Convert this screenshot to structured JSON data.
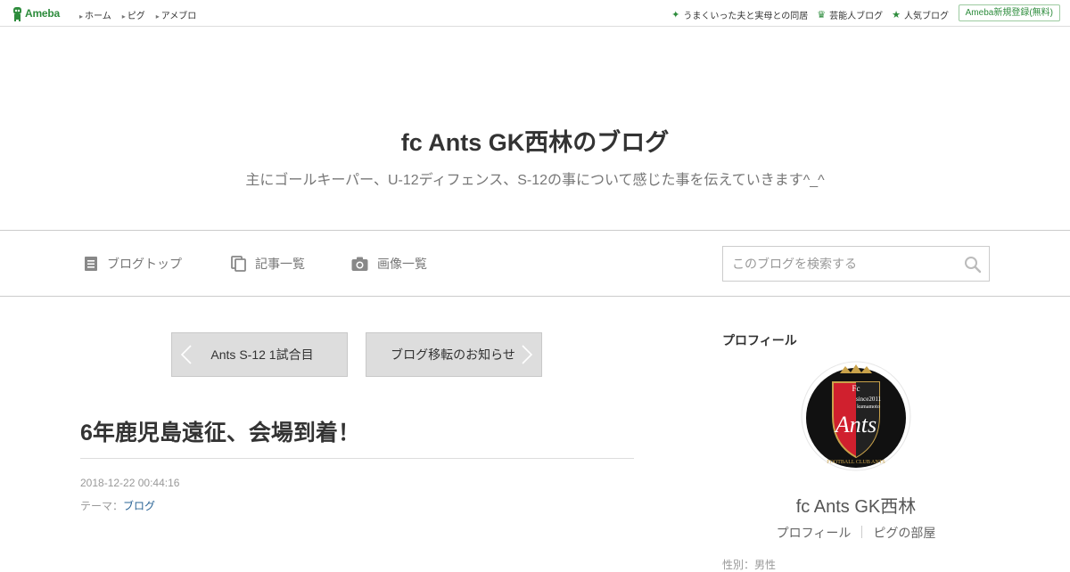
{
  "topbar": {
    "logo_text": "Ameba",
    "nav": [
      "ホーム",
      "ピグ",
      "アメブロ"
    ],
    "right_links": [
      {
        "icon": "sparkle-icon",
        "label": "うまくいった夫と実母との同居"
      },
      {
        "icon": "crown-icon",
        "label": "芸能人ブログ"
      },
      {
        "icon": "star-icon",
        "label": "人気ブログ"
      }
    ],
    "register_label": "Ameba新規登録(無料)"
  },
  "blog": {
    "title": "fc Ants GK西林のブログ",
    "description": "主にゴールキーパー、U-12ディフェンス、S-12の事について感じた事を伝えていきます^_^"
  },
  "blog_nav": {
    "items": [
      {
        "icon": "document-icon",
        "label": "ブログトップ"
      },
      {
        "icon": "copy-icon",
        "label": "記事一覧"
      },
      {
        "icon": "camera-icon",
        "label": "画像一覧"
      }
    ],
    "search_placeholder": "このブログを検索する"
  },
  "pager": {
    "prev_label": "Ants S-12 1試合目",
    "next_label": "ブログ移転のお知らせ"
  },
  "entry": {
    "title": "6年鹿児島遠征、会場到着！",
    "date": "2018-12-22 00:44:16",
    "theme_prefix": "テーマ：",
    "theme_link": "ブログ"
  },
  "sidebar": {
    "heading": "プロフィール",
    "avatar_text": {
      "top": "Fc",
      "since": "since2011",
      "city": "kumamoto",
      "name": "Ants",
      "ring": "FOOTBALL CLUB ANTS"
    },
    "name": "fc Ants GK西林",
    "links": [
      "プロフィール",
      "ピグの部屋"
    ],
    "cut_text": "性別：男性"
  },
  "colors": {
    "brand_green": "#2d8c3c",
    "link_blue": "#2a6496",
    "crest_red": "#d0202e"
  }
}
